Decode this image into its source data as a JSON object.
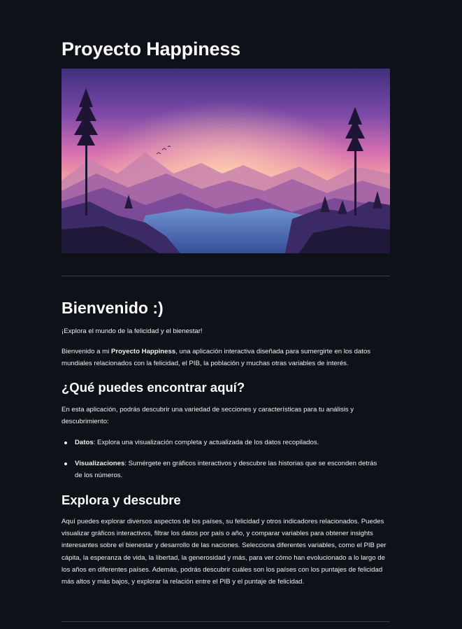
{
  "page": {
    "title": "Proyecto Happiness"
  },
  "welcome": {
    "heading": "Bienvenido :)",
    "tagline": "¡Explora el mundo de la felicidad y el bienestar!",
    "intro_before": "Bienvenido a mi ",
    "intro_bold": "Proyecto Happiness",
    "intro_after": ", una aplicación interactiva diseñada para sumergirte en los datos mundiales relacionados con la felicidad, el PIB, la población y muchas otras variables de interés."
  },
  "features": {
    "heading": "¿Qué puedes encontrar aquí?",
    "description": "En esta aplicación, podrás descubrir una variedad de secciones y características para tu análisis y descubrimiento:",
    "items": [
      {
        "name": "Datos",
        "text": ": Explora una visualización completa y actualizada de los datos recopilados."
      },
      {
        "name": "Visualizaciones",
        "text": ": Sumérgete en gráficos interactivos y descubre las historias que se esconden detrás de los números."
      }
    ]
  },
  "explore": {
    "heading": "Explora y descubre",
    "body": "Aquí puedes explorar diversos aspectos de los países, su felicidad y otros indicadores relacionados. Puedes visualizar gráficos interactivos, filtrar los datos por país o año, y comparar variables para obtener insights interesantes sobre el bienestar y desarrollo de las naciones. Selecciona diferentes variables, como el PIB per cápita, la esperanza de vida, la libertad, la generosidad y más, para ver cómo han evolucionado a lo largo de los años en diferentes países. Además, podrás descubrir cuáles son los países con los puntajes de felicidad más altos y más bajos, y explorar la relación entre el PIB y el puntaje de felicidad."
  },
  "colors": {
    "background": "#0e1117",
    "text": "#fafafa",
    "divider": "#3a3d46"
  }
}
